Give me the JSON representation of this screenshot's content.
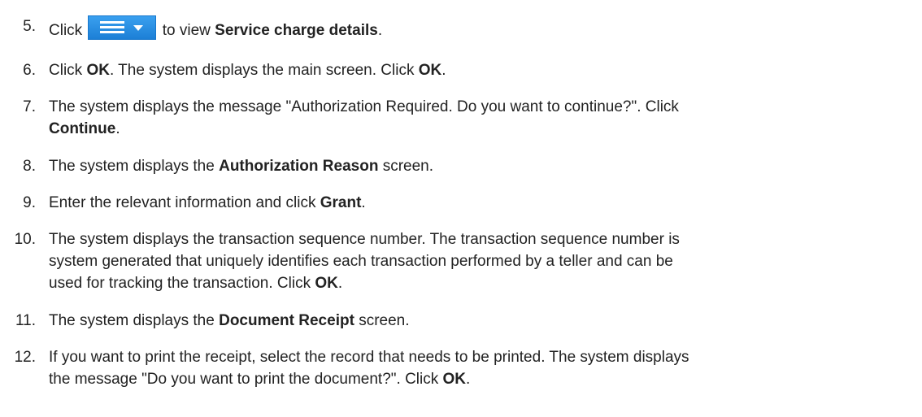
{
  "steps": [
    {
      "number": "5.",
      "before_icon": "Click",
      "icon": "menu-dropdown-icon",
      "after_icon": "to view",
      "bold": "Service charge details",
      "end": "."
    },
    {
      "number": "6.",
      "p1": "Click",
      "b1": "OK",
      "p2": ". The system displays the main screen. Click",
      "b2": "OK",
      "p3": "."
    },
    {
      "number": "7.",
      "line1": "The system displays the message \"Authorization Required. Do you want to continue?\". Click",
      "bold": "Continue",
      "end": "."
    },
    {
      "number": "8.",
      "p1": "The system displays the",
      "bold": "Authorization Reason",
      "p2": "screen."
    },
    {
      "number": "9.",
      "p1": "Enter the relevant information and click",
      "bold": "Grant",
      "p2": "."
    },
    {
      "number": "10.",
      "line1": "The system displays the transaction sequence number. The transaction sequence number is",
      "line2": "system generated that uniquely identifies each transaction performed by a teller and can be",
      "line3_pre": "used for tracking the transaction. Click",
      "bold": "OK",
      "end": "."
    },
    {
      "number": "11.",
      "p1": "The system displays the",
      "bold": "Document Receipt",
      "p2": "screen."
    },
    {
      "number": "12.",
      "line1": "If you want to print the receipt, select the record that needs to be printed. The system displays",
      "line2_pre": "the message \"Do you want to print the document?\". Click",
      "bold": "OK",
      "end": "."
    }
  ],
  "colors": {
    "text": "#222222",
    "button_blue": "#1c7fd6"
  }
}
